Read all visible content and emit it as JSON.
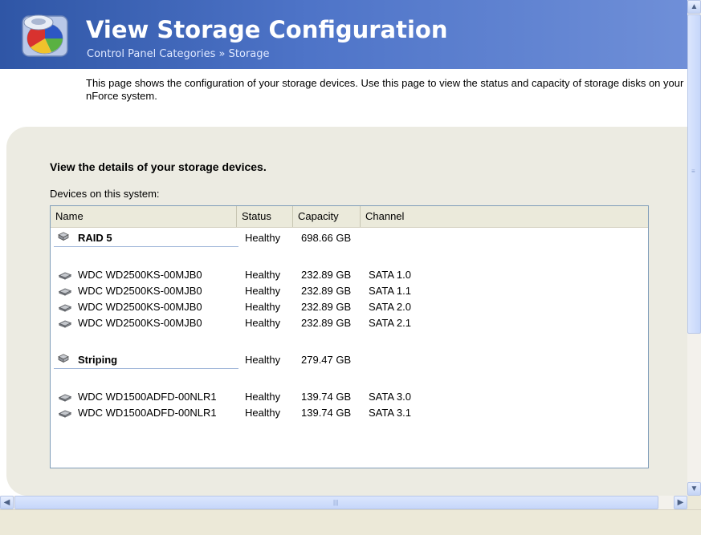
{
  "header": {
    "title": "View Storage Configuration",
    "breadcrumb_root": "Control Panel Categories",
    "breadcrumb_sep": "»",
    "breadcrumb_current": "Storage",
    "icon": "storage-pie-icon"
  },
  "intro": "This page shows the configuration of your storage devices. Use this page to view the status and capacity of storage disks on your nForce system.",
  "panel": {
    "heading": "View the details of your storage devices.",
    "devices_label": "Devices on this system:"
  },
  "table": {
    "columns": [
      "Name",
      "Status",
      "Capacity",
      "Channel"
    ],
    "rows": [
      {
        "type": "group",
        "name": "RAID 5",
        "status": "Healthy",
        "capacity": "698.66 GB",
        "channel": "",
        "icon": "array-icon"
      },
      {
        "type": "disk",
        "name": "WDC WD2500KS-00MJB0",
        "status": "Healthy",
        "capacity": "232.89 GB",
        "channel": "SATA 1.0",
        "icon": "disk-icon"
      },
      {
        "type": "disk",
        "name": "WDC WD2500KS-00MJB0",
        "status": "Healthy",
        "capacity": "232.89 GB",
        "channel": "SATA 1.1",
        "icon": "disk-icon"
      },
      {
        "type": "disk",
        "name": "WDC WD2500KS-00MJB0",
        "status": "Healthy",
        "capacity": "232.89 GB",
        "channel": "SATA 2.0",
        "icon": "disk-icon"
      },
      {
        "type": "disk",
        "name": "WDC WD2500KS-00MJB0",
        "status": "Healthy",
        "capacity": "232.89 GB",
        "channel": "SATA 2.1",
        "icon": "disk-icon"
      },
      {
        "type": "group",
        "name": "Striping",
        "status": "Healthy",
        "capacity": "279.47 GB",
        "channel": "",
        "icon": "array-icon"
      },
      {
        "type": "disk",
        "name": "WDC WD1500ADFD-00NLR1",
        "status": "Healthy",
        "capacity": "139.74 GB",
        "channel": "SATA 3.0",
        "icon": "disk-icon"
      },
      {
        "type": "disk",
        "name": "WDC WD1500ADFD-00NLR1",
        "status": "Healthy",
        "capacity": "139.74 GB",
        "channel": "SATA 3.1",
        "icon": "disk-icon"
      }
    ]
  },
  "colors": {
    "header_start": "#2f56a6",
    "header_end": "#6f8fd8",
    "panel_bg": "#ecebe2",
    "list_border": "#7f9db9"
  }
}
